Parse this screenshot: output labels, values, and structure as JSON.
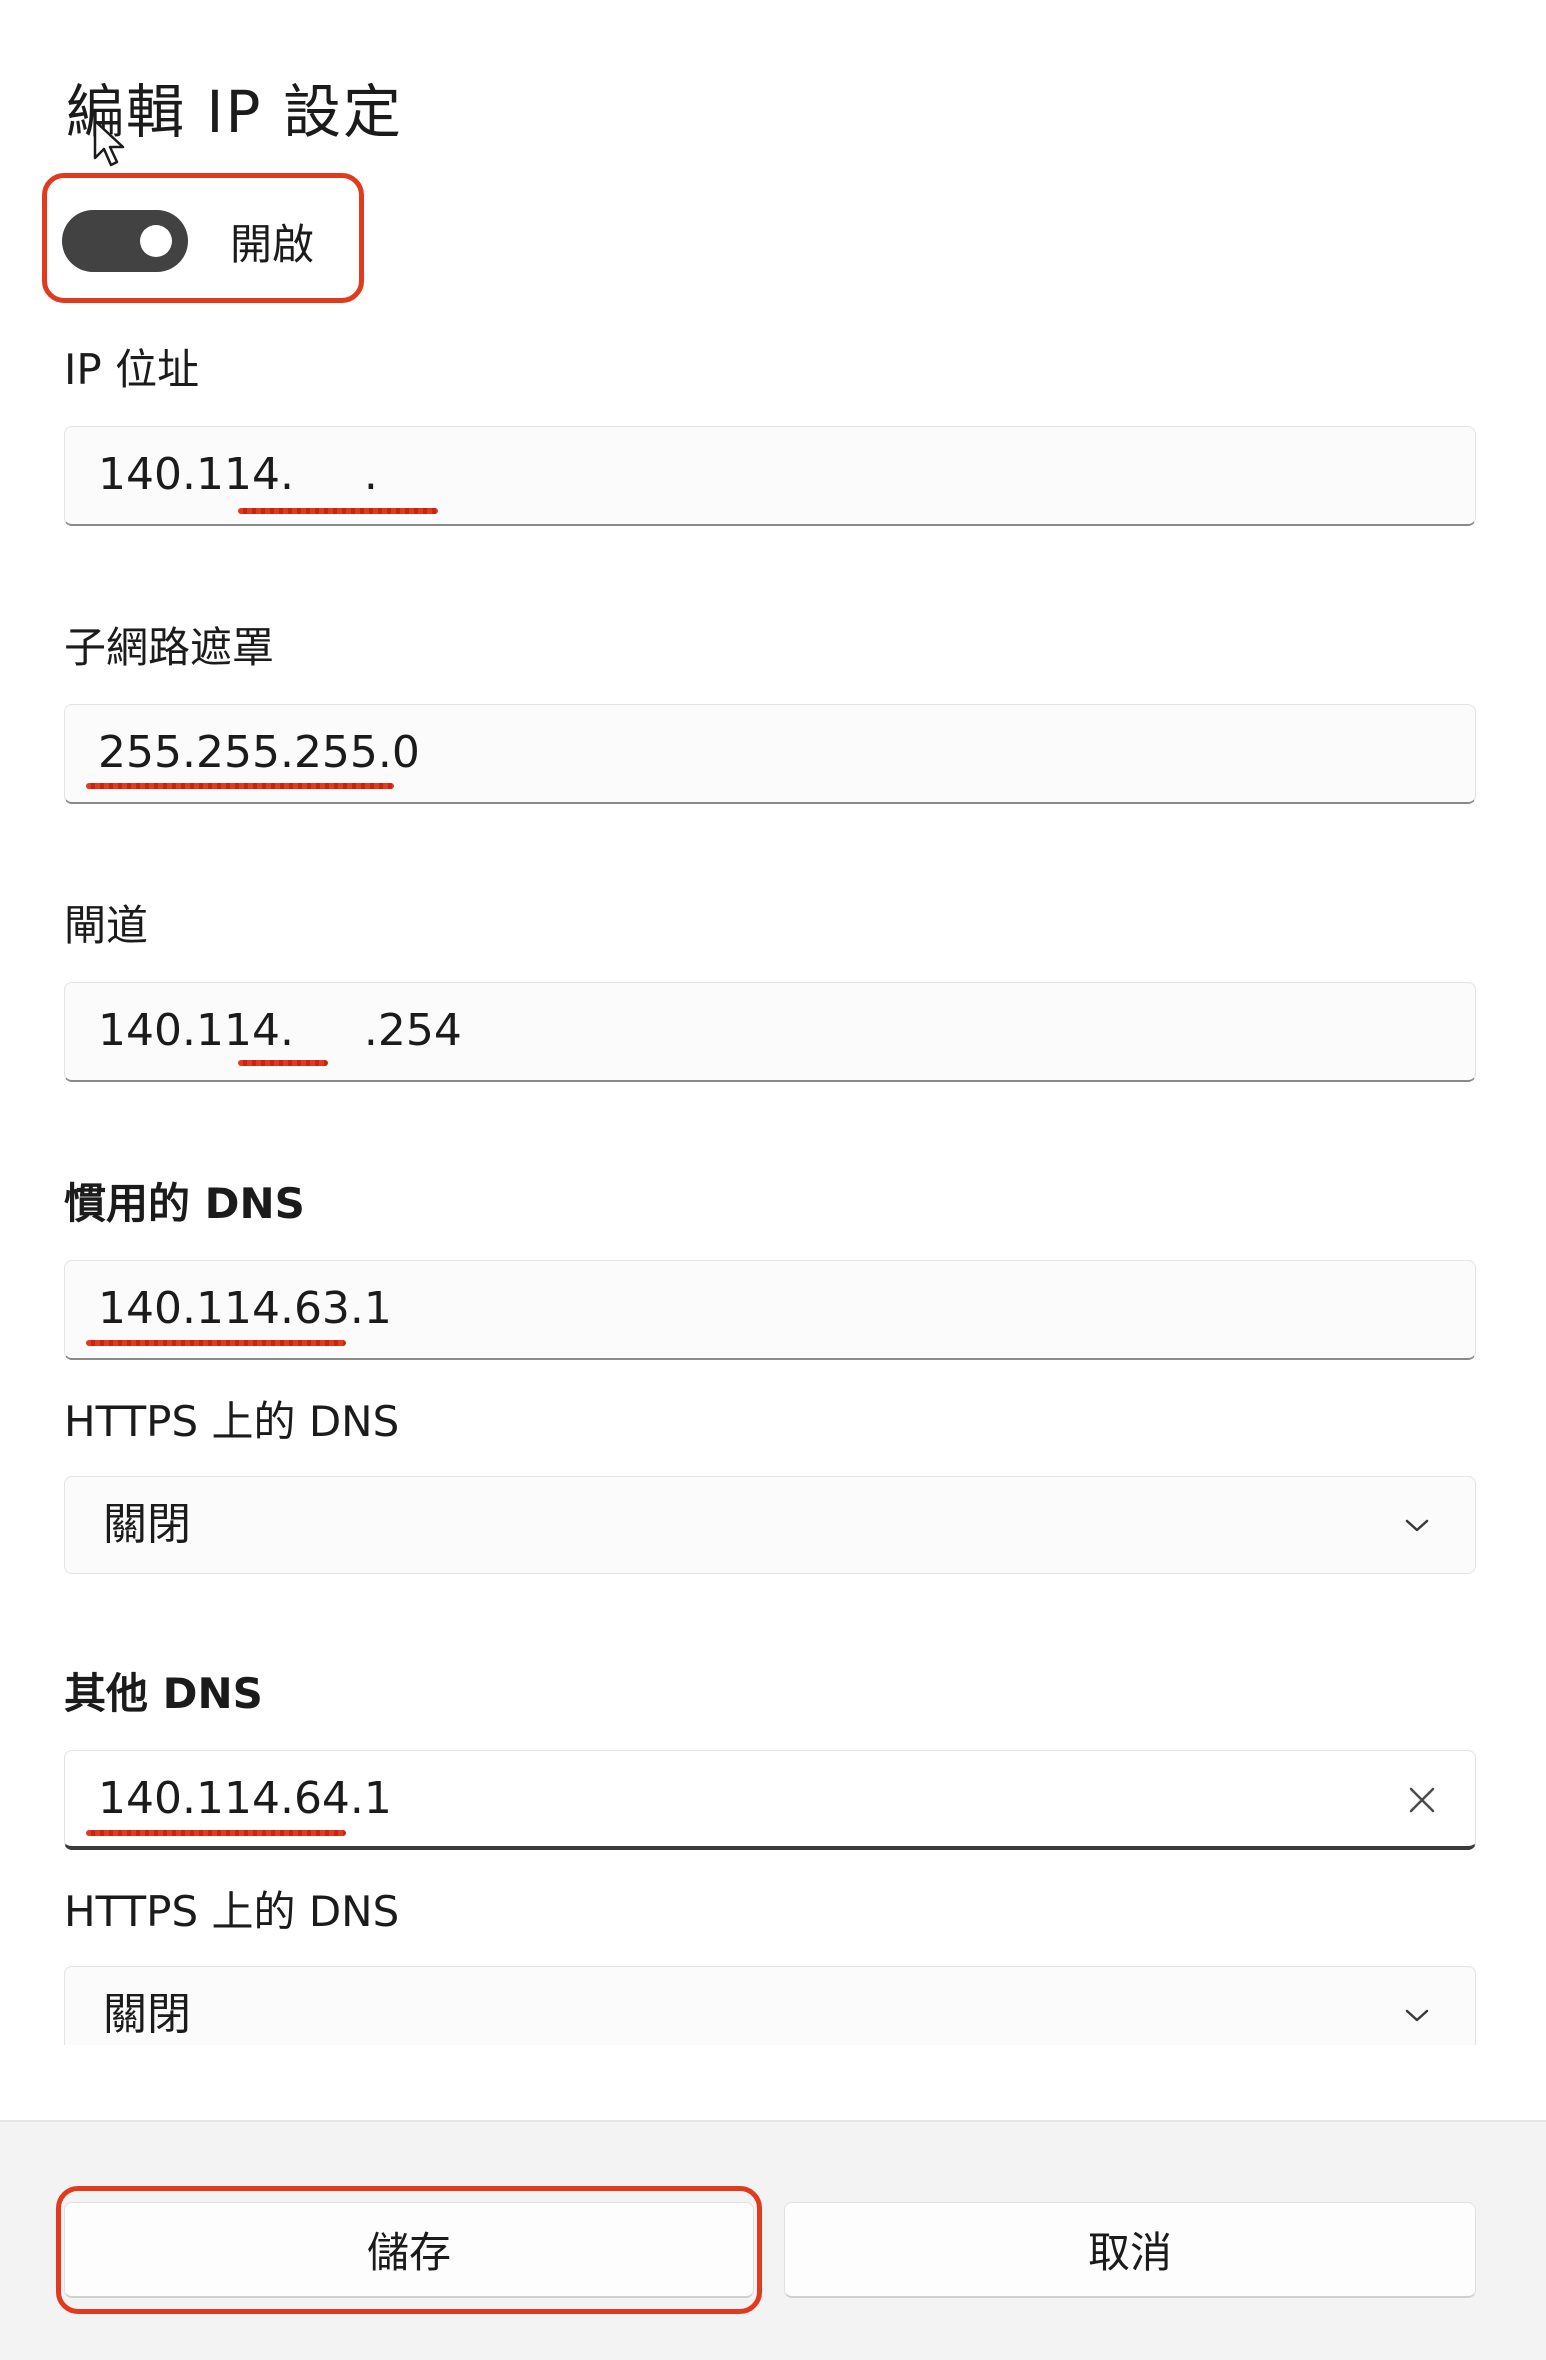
{
  "dialog": {
    "title": "編輯 IP 設定",
    "toggle": {
      "state": "on",
      "label": "開啟"
    }
  },
  "fields": {
    "ip_address": {
      "label": "IP 位址",
      "value": "140.114.     ."
    },
    "subnet_mask": {
      "label": "子網路遮罩",
      "value": "255.255.255.0"
    },
    "gateway": {
      "label": "閘道",
      "value": "140.114.     .254"
    },
    "preferred_dns": {
      "label": "慣用的 DNS",
      "value": "140.114.63.1",
      "https_label": "HTTPS 上的 DNS",
      "https_value": "關閉"
    },
    "alternate_dns": {
      "label": "其他 DNS",
      "value": "140.114.64.1",
      "https_label": "HTTPS 上的 DNS",
      "https_value": "關閉"
    }
  },
  "buttons": {
    "save": "儲存",
    "cancel": "取消"
  },
  "colors": {
    "highlight": "#e23a1e",
    "toggle_on": "#424242",
    "background": "#ffffff",
    "footer": "#f3f3f3"
  },
  "icons": {
    "clear": "close-icon",
    "dropdown": "chevron-down-icon",
    "cursor": "mouse-pointer-icon"
  }
}
